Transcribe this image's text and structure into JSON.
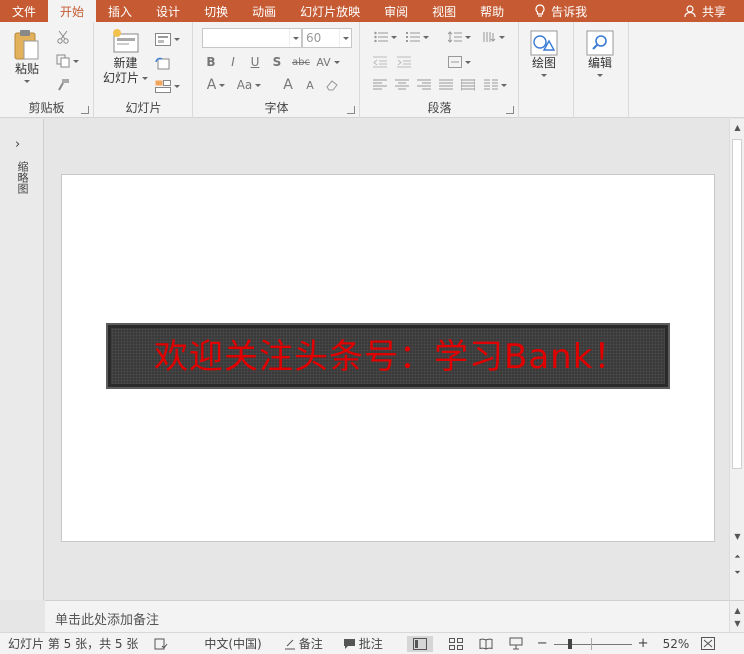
{
  "tabs": [
    {
      "label": "文件",
      "active": false
    },
    {
      "label": "开始",
      "active": true
    },
    {
      "label": "插入",
      "active": false
    },
    {
      "label": "设计",
      "active": false
    },
    {
      "label": "切换",
      "active": false
    },
    {
      "label": "动画",
      "active": false
    },
    {
      "label": "幻灯片放映",
      "active": false
    },
    {
      "label": "审阅",
      "active": false
    },
    {
      "label": "视图",
      "active": false
    },
    {
      "label": "帮助",
      "active": false
    }
  ],
  "tell_me": "告诉我",
  "share": "共享",
  "ribbon": {
    "clipboard": {
      "label": "剪贴板",
      "paste": "粘贴"
    },
    "slides": {
      "label": "幻灯片",
      "new_slide_line1": "新建",
      "new_slide_line2": "幻灯片"
    },
    "font": {
      "label": "字体",
      "font_size": "60",
      "bold": "B",
      "italic": "I",
      "underline": "U",
      "shadow": "S",
      "strike": "abc",
      "spacing": "AV",
      "font_color": "A",
      "change_case": "Aa",
      "grow": "A",
      "shrink": "A"
    },
    "paragraph": {
      "label": "段落"
    },
    "drawing": {
      "label": "绘图"
    },
    "editing": {
      "label": "编辑"
    }
  },
  "thumbnail_pane": {
    "label": "缩略图"
  },
  "slide": {
    "banner_text": "欢迎关注头条号：学习Bank！"
  },
  "notes": {
    "placeholder": "单击此处添加备注"
  },
  "status": {
    "slide_info": "幻灯片 第 5 张，共 5 张",
    "language": "中文(中国)",
    "notes_label": "备注",
    "comments_label": "批注",
    "zoom": "52%"
  },
  "colors": {
    "accent": "#c55a33",
    "led_text": "#e00000"
  }
}
